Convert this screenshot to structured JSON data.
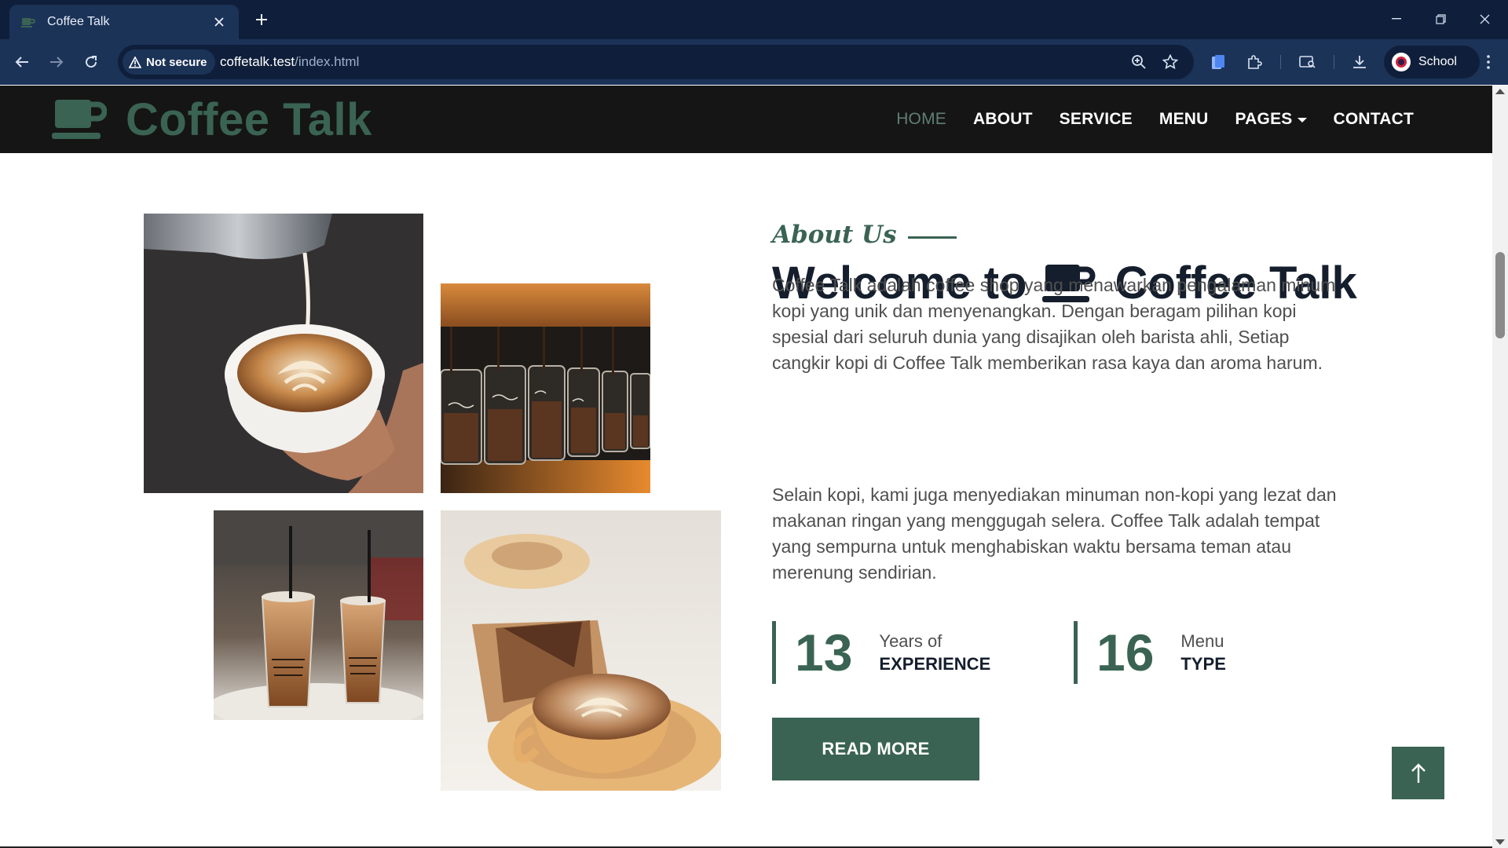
{
  "browser": {
    "tab_title": "Coffee Talk",
    "security_label": "Not secure",
    "url_host": "coffetalk.test",
    "url_path": "/index.html",
    "profile_name": "School",
    "icons": [
      "favicon-cup-icon",
      "tab-close-icon",
      "new-tab-icon",
      "minimize-icon",
      "restore-icon",
      "window-close-icon",
      "back-icon",
      "forward-icon",
      "reload-icon",
      "warning-icon",
      "zoom-icon",
      "bookmark-star-icon",
      "side-panel-icon",
      "extensions-icon",
      "tab-search-icon",
      "downloads-icon",
      "profile-icon",
      "menu-kebab-icon"
    ]
  },
  "site": {
    "brand_name": "Coffee Talk",
    "nav": [
      {
        "label": "HOME",
        "active": true
      },
      {
        "label": "ABOUT",
        "active": false
      },
      {
        "label": "SERVICE",
        "active": false
      },
      {
        "label": "MENU",
        "active": false
      },
      {
        "label": "PAGES",
        "active": false,
        "dropdown": true
      },
      {
        "label": "CONTACT",
        "active": false
      }
    ]
  },
  "about": {
    "eyebrow": "About Us",
    "title_pre": "Welcome to",
    "title_post": "Coffee Talk",
    "paragraph_1": "Coffee Talk adalah coffee shop yang menawarkan pengalaman minum kopi yang unik dan menyenangkan. Dengan beragam pilihan kopi spesial dari seluruh dunia yang disajikan oleh barista ahli, Setiap cangkir kopi di Coffee Talk memberikan rasa kaya dan aroma harum.",
    "paragraph_2": "Selain kopi, kami juga menyediakan minuman non-kopi yang lezat dan makanan ringan yang menggugah selera. Coffee Talk adalah tempat yang sempurna untuk menghabiskan waktu bersama teman atau merenung sendirian.",
    "stats": [
      {
        "number": "13",
        "line1": "Years of",
        "line2": "EXPERIENCE"
      },
      {
        "number": "16",
        "line1": "Menu",
        "line2": "TYPE"
      }
    ],
    "button_label": "READ MORE"
  },
  "colors": {
    "brand_green": "#3a6353",
    "navbar_bg": "#151515",
    "text_dark": "#151e2c",
    "text_body": "#4f4f4f"
  }
}
